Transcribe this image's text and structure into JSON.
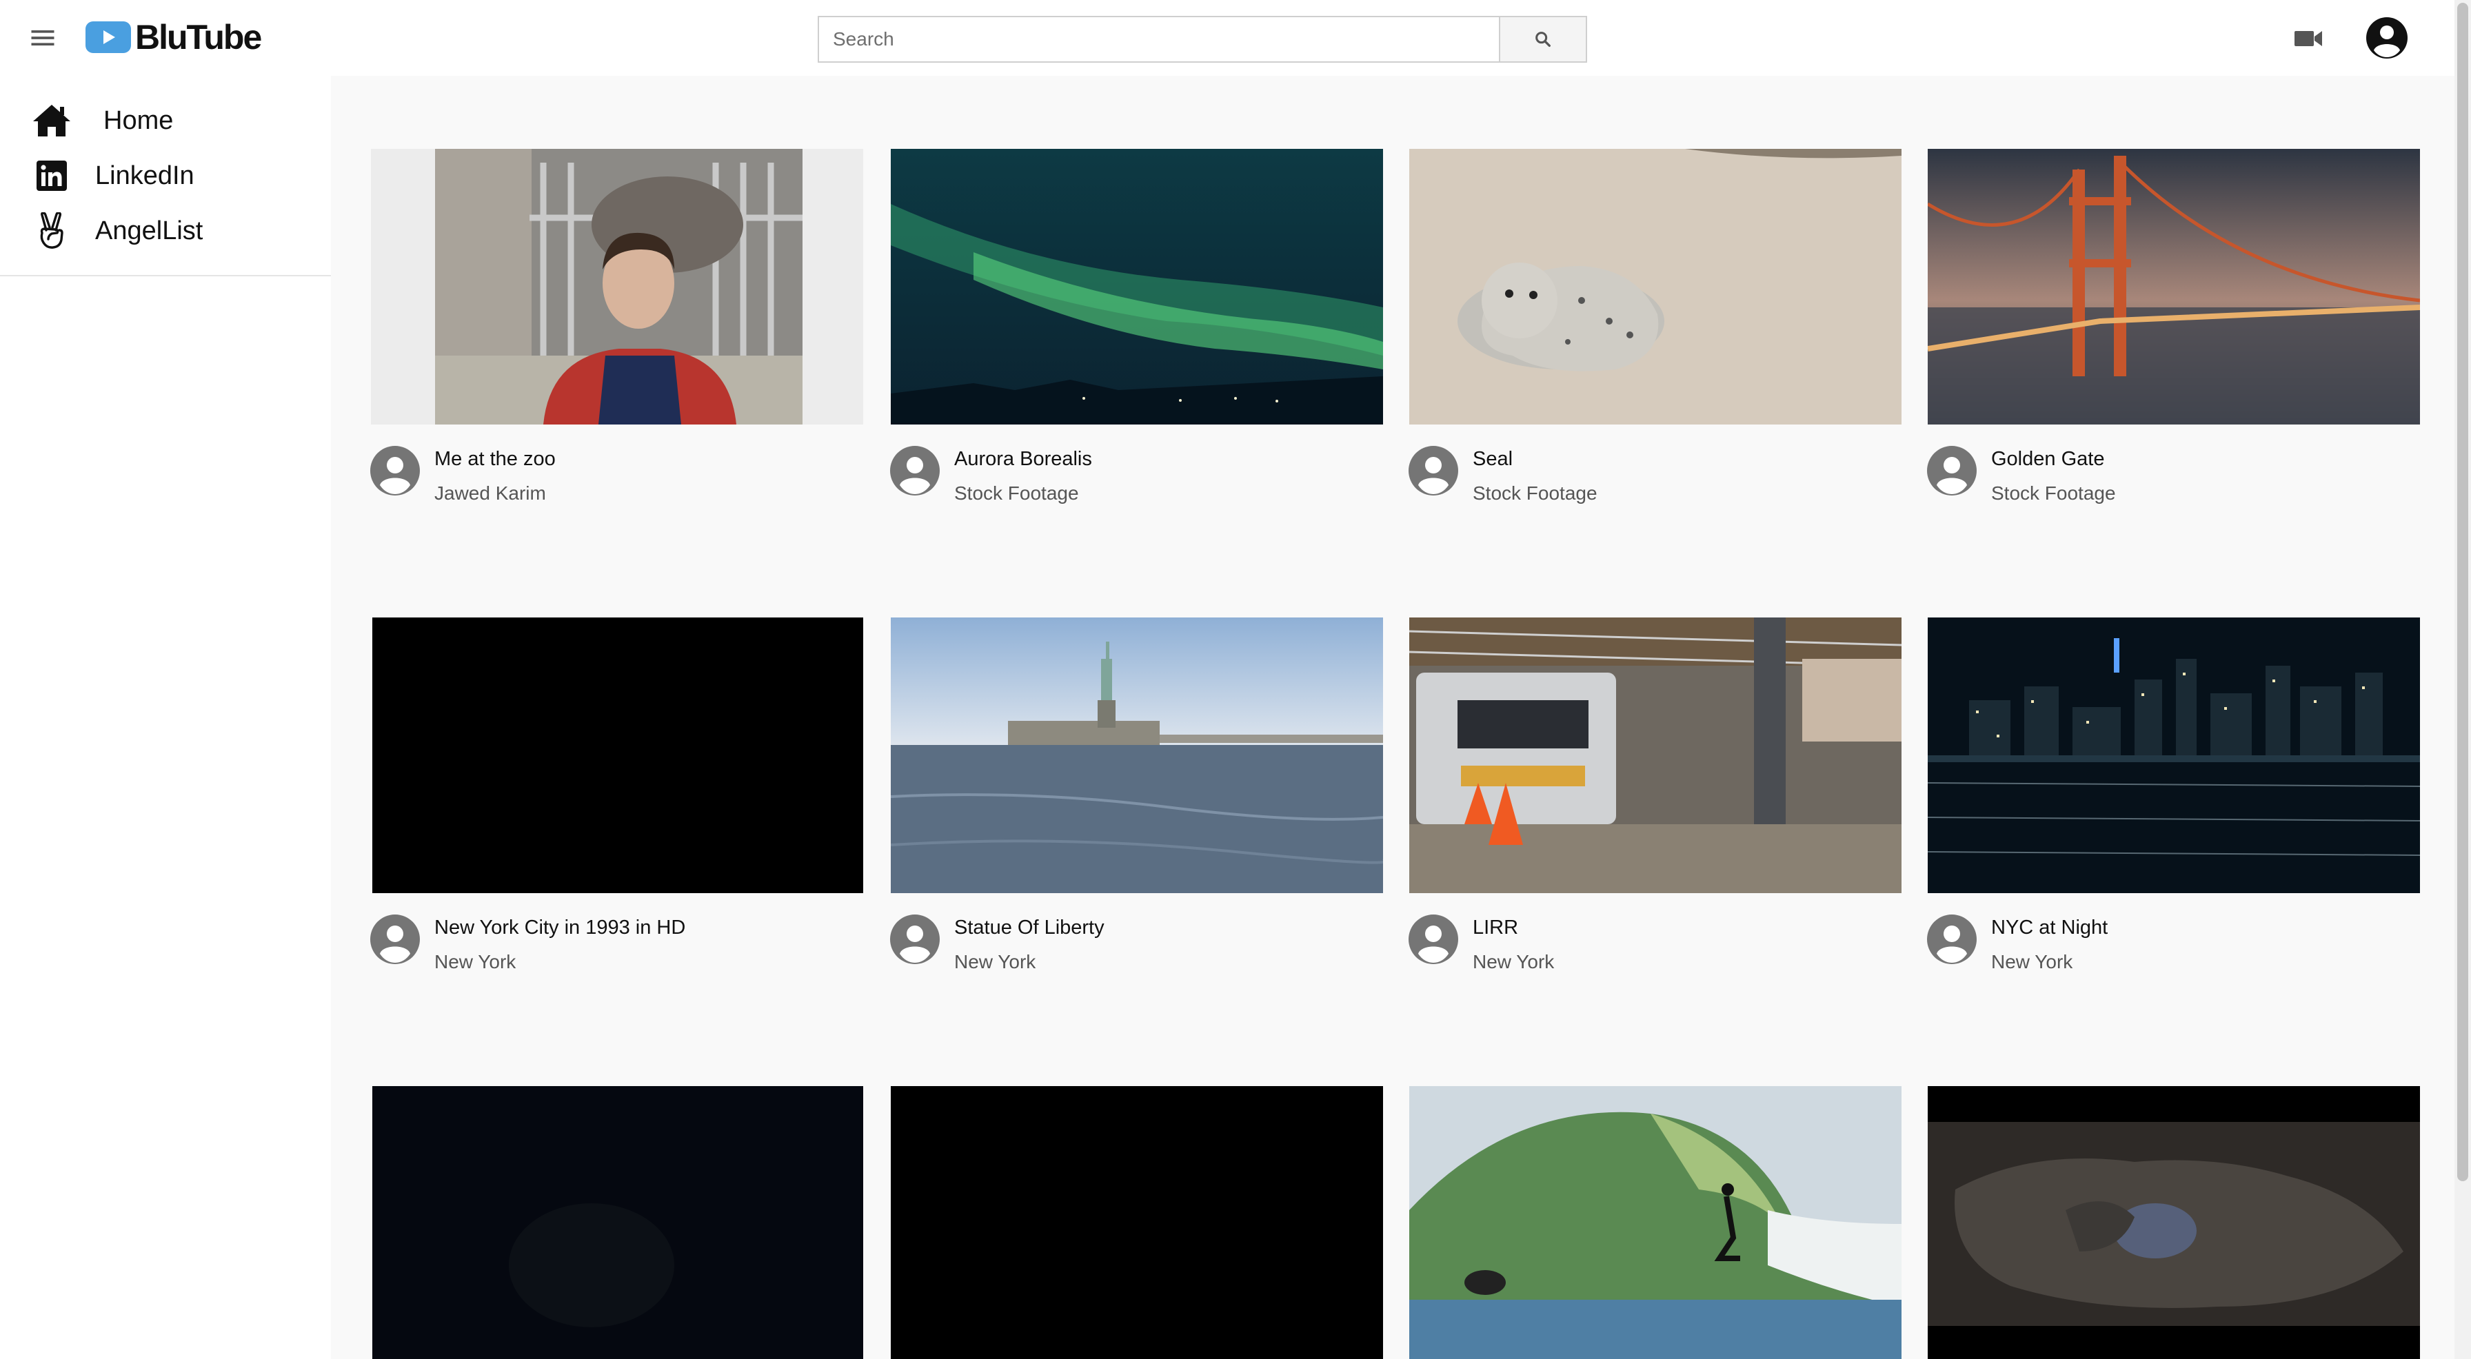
{
  "app": {
    "name": "BluTube"
  },
  "header": {
    "search_placeholder": "Search"
  },
  "sidebar": {
    "items": [
      {
        "label": "Home",
        "icon": "home-icon"
      },
      {
        "label": "LinkedIn",
        "icon": "linkedin-icon"
      },
      {
        "label": "AngelList",
        "icon": "angellist-icon"
      }
    ]
  },
  "videos": [
    {
      "title": "Me at the zoo",
      "channel": "Jawed Karim"
    },
    {
      "title": "Aurora Borealis",
      "channel": "Stock Footage"
    },
    {
      "title": "Seal",
      "channel": "Stock Footage"
    },
    {
      "title": "Golden Gate",
      "channel": "Stock Footage"
    },
    {
      "title": "New York City in 1993 in HD",
      "channel": "New York"
    },
    {
      "title": "Statue Of Liberty",
      "channel": "New York"
    },
    {
      "title": "LIRR",
      "channel": "New York"
    },
    {
      "title": "NYC at Night",
      "channel": "New York"
    }
  ],
  "colors": {
    "logo_blue": "#4a9fe0",
    "avatar_gray": "#757575",
    "accent_text": "#111111"
  }
}
